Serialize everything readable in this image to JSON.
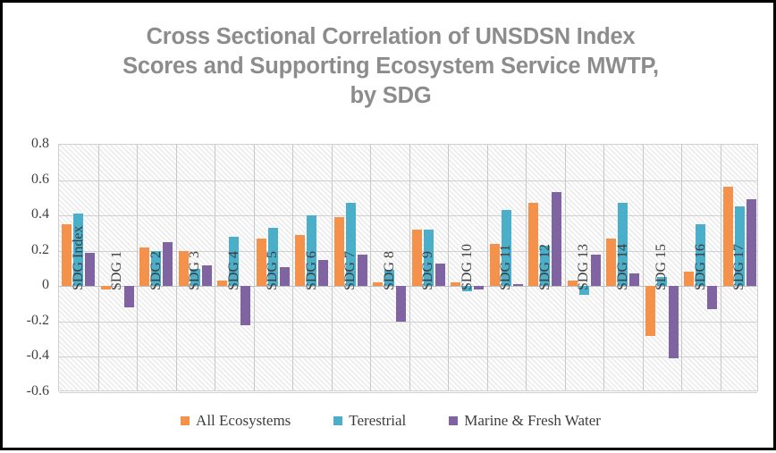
{
  "chart_data": {
    "type": "bar",
    "title": "Cross Sectional Correlation of UNSDSN Index Scores and Supporting Ecosystem Service MWTP, by SDG",
    "title_lines": [
      "Cross Sectional Correlation of UNSDSN Index",
      "Scores and Supporting Ecosystem Service MWTP,",
      "by SDG"
    ],
    "xlabel": "",
    "ylabel": "",
    "ylim": [
      -0.6,
      0.8
    ],
    "ytick_labels": [
      "0.8",
      "0.6",
      "0.4",
      "0.2",
      "0",
      "-0.2",
      "-0.4",
      "-0.6"
    ],
    "ytick_values": [
      0.8,
      0.6,
      0.4,
      0.2,
      0,
      -0.2,
      -0.4,
      -0.6
    ],
    "grid": true,
    "legend_position": "bottom",
    "categories": [
      "SDG Index",
      "SDG 1",
      "SDG 2",
      "SDG 3",
      "SDG 4",
      "SDG 5",
      "SDG 6",
      "SDG 7",
      "SDG 8",
      "SDG 9",
      "SDG 10",
      "SDG 11",
      "SDG 12",
      "SDG 13",
      "SDG 14",
      "SDG 15",
      "SDG 16",
      "SDG 17"
    ],
    "series": [
      {
        "name": "All Ecosystems",
        "color": "#F4924B",
        "values": [
          0.35,
          -0.02,
          0.22,
          0.2,
          0.03,
          0.27,
          0.29,
          0.39,
          0.02,
          0.32,
          0.02,
          0.24,
          0.47,
          0.03,
          0.27,
          -0.28,
          0.08,
          0.56
        ]
      },
      {
        "name": "Terestrial",
        "color": "#4BAFC9",
        "values": [
          0.41,
          0.0,
          0.2,
          0.1,
          0.28,
          0.33,
          0.4,
          0.47,
          0.09,
          0.32,
          -0.03,
          0.43,
          0.23,
          -0.05,
          0.47,
          0.05,
          0.35,
          0.45
        ]
      },
      {
        "name": "Marine & Fresh Water",
        "color": "#8064A2",
        "values": [
          0.19,
          -0.12,
          0.25,
          0.12,
          -0.22,
          0.11,
          0.15,
          0.18,
          -0.2,
          0.13,
          -0.02,
          0.01,
          0.53,
          0.18,
          0.07,
          -0.41,
          -0.13,
          0.49
        ]
      }
    ]
  }
}
